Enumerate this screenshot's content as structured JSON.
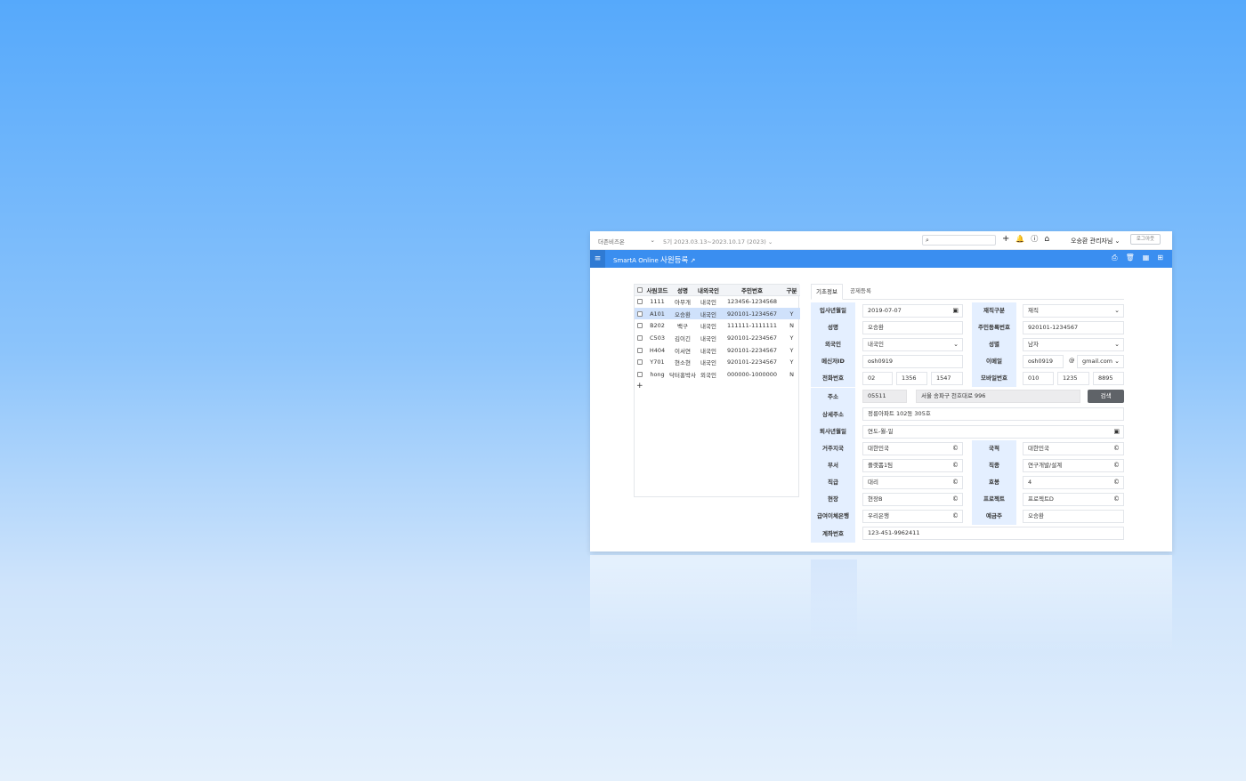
{
  "topbar": {
    "company": "더존비즈온",
    "period": "5기 2023.03.13~2023.10.17 (2023)",
    "user": "오승환 관리자님",
    "logout": "로그아웃"
  },
  "header": {
    "app_name": "SmartA Online",
    "page_title": "사원등록"
  },
  "grid": {
    "headers": [
      "사원코드",
      "성명",
      "내외국인",
      "주민번호",
      "구분"
    ],
    "rows": [
      {
        "code": "1111",
        "name": "아무개",
        "nation": "내국인",
        "id": "123456-1234568",
        "type": ""
      },
      {
        "code": "A101",
        "name": "오승환",
        "nation": "내국인",
        "id": "920101-1234567",
        "type": "Y"
      },
      {
        "code": "B202",
        "name": "백구",
        "nation": "내국인",
        "id": "111111-1111111",
        "type": "N"
      },
      {
        "code": "C503",
        "name": "김이긴",
        "nation": "내국인",
        "id": "920101-2234567",
        "type": "Y"
      },
      {
        "code": "H404",
        "name": "이서연",
        "nation": "내국인",
        "id": "920101-2234567",
        "type": "Y"
      },
      {
        "code": "Y701",
        "name": "현소현",
        "nation": "내국인",
        "id": "920101-2234567",
        "type": "Y"
      },
      {
        "code": "hong",
        "name": "닥터홍박사",
        "nation": "외국인",
        "id": "000000-1000000",
        "type": "N"
      }
    ]
  },
  "tabs": [
    "기초정보",
    "공제등록"
  ],
  "form": {
    "hire_date": {
      "label": "입사년월일",
      "value": "2019-07-07"
    },
    "status": {
      "label": "재직구분",
      "value": "재직"
    },
    "name": {
      "label": "성명",
      "value": "오승환"
    },
    "rrn": {
      "label": "주민등록번호",
      "value": "920101-1234567"
    },
    "foreigner": {
      "label": "외국인",
      "value": "내국인"
    },
    "gender": {
      "label": "성별",
      "value": "남자"
    },
    "messenger": {
      "label": "메신저ID",
      "value": "osh0919"
    },
    "email": {
      "label": "이메일",
      "user": "osh0919",
      "domain": "gmail.com"
    },
    "phone": {
      "label": "전화번호",
      "p1": "02",
      "p2": "1356",
      "p3": "1547"
    },
    "mobile": {
      "label": "모바일번호",
      "p1": "010",
      "p2": "1235",
      "p3": "8895"
    },
    "address": {
      "label": "주소",
      "zip": "05511",
      "road": "서울 송파구 천호대로 996",
      "button": "검색"
    },
    "detail_address": {
      "label": "상세주소",
      "value": "정릉아파트 102동 305호"
    },
    "leave_date": {
      "label": "퇴사년월일",
      "value": "연도-월-일"
    },
    "residence": {
      "label": "거주지국",
      "value": "대한민국"
    },
    "nationality": {
      "label": "국적",
      "value": "대한민국"
    },
    "dept": {
      "label": "부서",
      "value": "플랫폼1팀"
    },
    "job": {
      "label": "직종",
      "value": "연구개발/설계"
    },
    "rank": {
      "label": "직급",
      "value": "대리"
    },
    "step": {
      "label": "호봉",
      "value": "4"
    },
    "site": {
      "label": "현장",
      "value": "현장B"
    },
    "project": {
      "label": "프로젝트",
      "value": "프로젝트D"
    },
    "bank": {
      "label": "급여이체은행",
      "value": "우리은행"
    },
    "holder": {
      "label": "예금주",
      "value": "오승환"
    },
    "account": {
      "label": "계좌번호",
      "value": "123-451-9962411"
    }
  },
  "icons": {
    "copyright": "©",
    "at": "@"
  }
}
